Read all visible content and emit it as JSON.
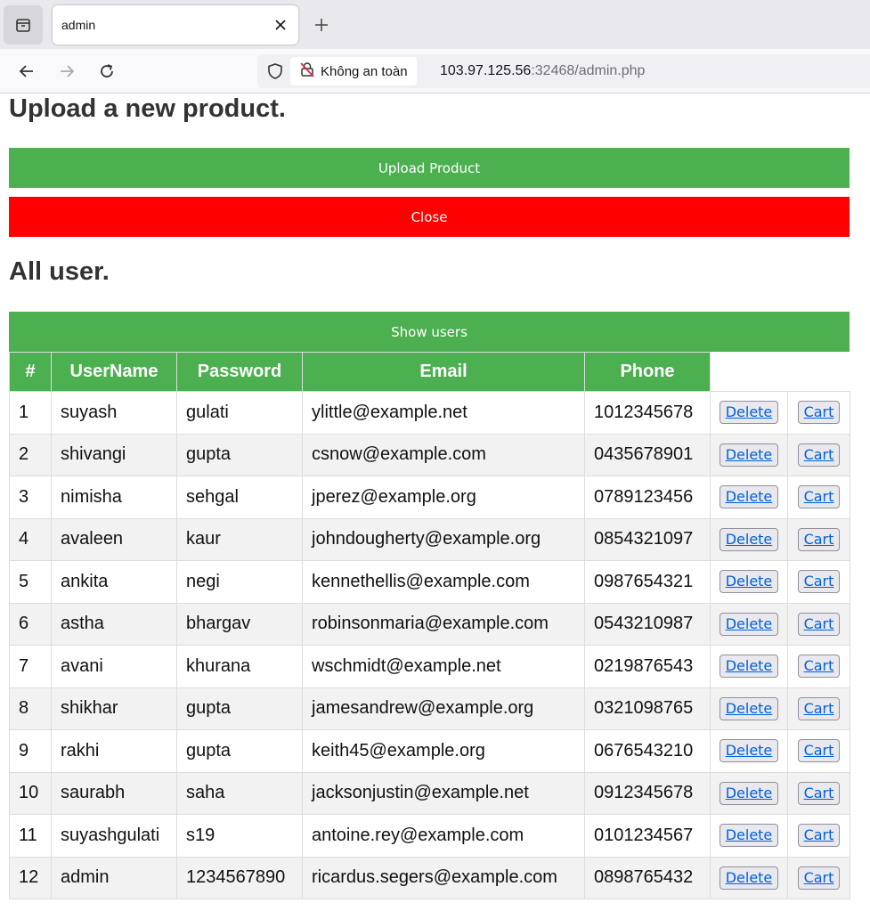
{
  "browser": {
    "tab_title": "admin",
    "security_label": "Không an toàn",
    "url_host": "103.97.125.56",
    "url_rest": ":32468/admin.php"
  },
  "page": {
    "upload_heading": "Upload a new product.",
    "upload_button": "Upload Product",
    "close_button": "Close",
    "users_heading": "All user.",
    "show_users_button": "Show users"
  },
  "table": {
    "headers": [
      "#",
      "UserName",
      "Password",
      "Email",
      "Phone"
    ],
    "delete_label": "Delete",
    "cart_label": "Cart",
    "rows": [
      [
        "1",
        "suyash",
        "gulati",
        "ylittle@example.net",
        "1012345678"
      ],
      [
        "2",
        "shivangi",
        "gupta",
        "csnow@example.com",
        "0435678901"
      ],
      [
        "3",
        "nimisha",
        "sehgal",
        "jperez@example.org",
        "0789123456"
      ],
      [
        "4",
        "avaleen",
        "kaur",
        "johndougherty@example.org",
        "0854321097"
      ],
      [
        "5",
        "ankita",
        "negi",
        "kennethellis@example.com",
        "0987654321"
      ],
      [
        "6",
        "astha",
        "bhargav",
        "robinsonmaria@example.com",
        "0543210987"
      ],
      [
        "7",
        "avani",
        "khurana",
        "wschmidt@example.net",
        "0219876543"
      ],
      [
        "8",
        "shikhar",
        "gupta",
        "jamesandrew@example.org",
        "0321098765"
      ],
      [
        "9",
        "rakhi",
        "gupta",
        "keith45@example.org",
        "0676543210"
      ],
      [
        "10",
        "saurabh",
        "saha",
        "jacksonjustin@example.net",
        "0912345678"
      ],
      [
        "11",
        "suyashgulati",
        "s19",
        "antoine.rey@example.com",
        "0101234567"
      ],
      [
        "12",
        "admin",
        "1234567890",
        "ricardus.segers@example.com",
        "0898765432"
      ]
    ]
  },
  "colors": {
    "accent_green": "#4caf50",
    "close_red": "#ff0000",
    "row_alt": "#f2f2f2"
  }
}
